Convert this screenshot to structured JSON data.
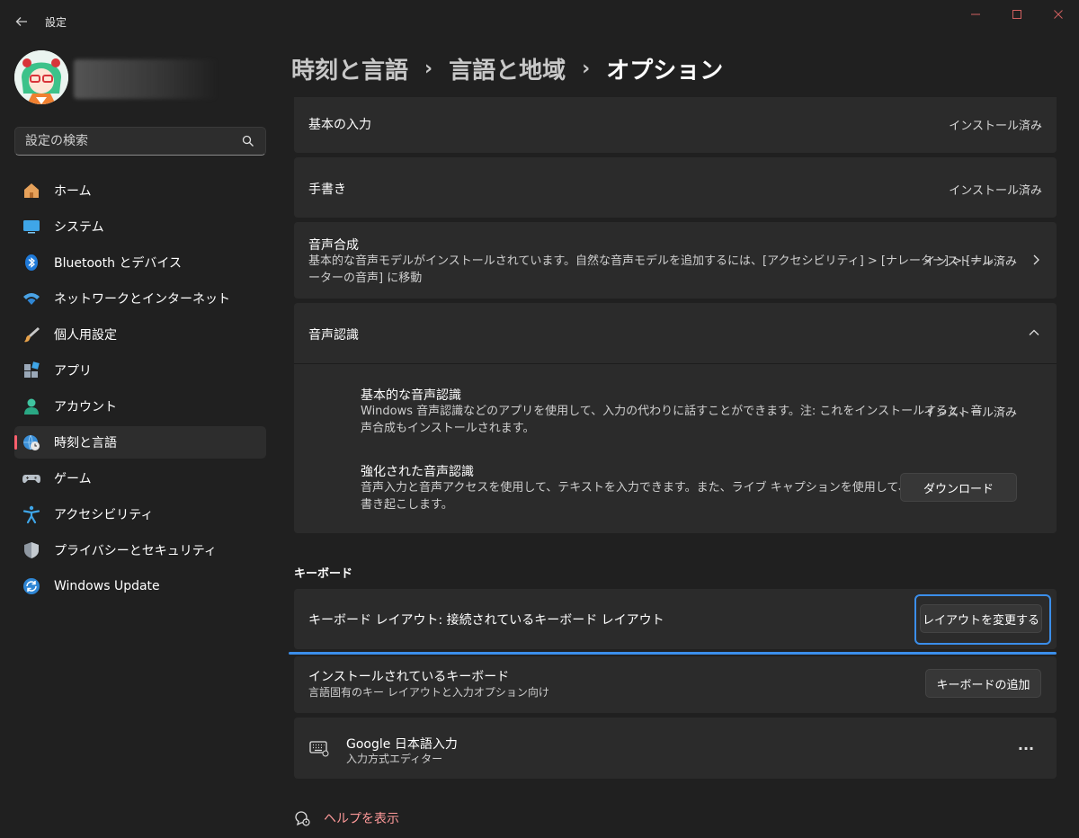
{
  "window": {
    "title": "設定"
  },
  "sidebar": {
    "search_placeholder": "設定の検索",
    "items": [
      {
        "label": "ホーム",
        "icon": "home-icon"
      },
      {
        "label": "システム",
        "icon": "monitor-icon"
      },
      {
        "label": "Bluetooth とデバイス",
        "icon": "bluetooth-icon"
      },
      {
        "label": "ネットワークとインターネット",
        "icon": "wifi-icon"
      },
      {
        "label": "個人用設定",
        "icon": "brush-icon"
      },
      {
        "label": "アプリ",
        "icon": "apps-icon"
      },
      {
        "label": "アカウント",
        "icon": "account-icon"
      },
      {
        "label": "時刻と言語",
        "icon": "globe-clock-icon",
        "active": true
      },
      {
        "label": "ゲーム",
        "icon": "gamepad-icon"
      },
      {
        "label": "アクセシビリティ",
        "icon": "accessibility-icon"
      },
      {
        "label": "プライバシーとセキュリティ",
        "icon": "shield-icon"
      },
      {
        "label": "Windows Update",
        "icon": "update-icon"
      }
    ]
  },
  "breadcrumb": {
    "items": [
      "時刻と言語",
      "言語と地域",
      "オプション"
    ],
    "separator": "›"
  },
  "features": {
    "basic_input": {
      "title": "基本の入力",
      "status": "インストール済み"
    },
    "handwriting": {
      "title": "手書き",
      "status": "インストール済み"
    },
    "tts": {
      "title": "音声合成",
      "desc_line1": "基本的な音声モデルがインストールされています。自然な音声モデルを追加するには、[アクセシビリティ] > [ナレーター] > [ナレ",
      "desc_line2": "ーターの音声] に移動",
      "status": "インストール済み"
    },
    "speech": {
      "title": "音声認識",
      "basic": {
        "title": "基本的な音声認識",
        "desc_line1": "Windows 音声認識などのアプリを使用して、入力の代わりに話すことができます。注: これをインストールすると、音",
        "desc_line2": "声合成もインストールされます。",
        "status": "インストール済み"
      },
      "enhanced": {
        "title": "強化された音声認識",
        "desc_line1": "音声入力と音声アクセスを使用して、テキストを入力できます。また、ライブ キャプションを使用して、音声を",
        "desc_line2": "書き起こします。",
        "button": "ダウンロード"
      }
    }
  },
  "keyboard": {
    "section_label": "キーボード",
    "layout": {
      "title": "キーボード レイアウト: 接続されているキーボード レイアウト",
      "button": "レイアウトを変更する"
    },
    "installed": {
      "title": "インストールされているキーボード",
      "desc": "言語固有のキー レイアウトと入力オプション向け",
      "button": "キーボードの追加"
    },
    "ime": {
      "title": "Google 日本語入力",
      "desc": "入力方式エディター",
      "more": "···"
    }
  },
  "help": {
    "label": "ヘルプを表示"
  },
  "colors": {
    "accent": "#3b8eea",
    "active_indicator": "#ff5f6d",
    "help_link": "#ff9a9a"
  }
}
